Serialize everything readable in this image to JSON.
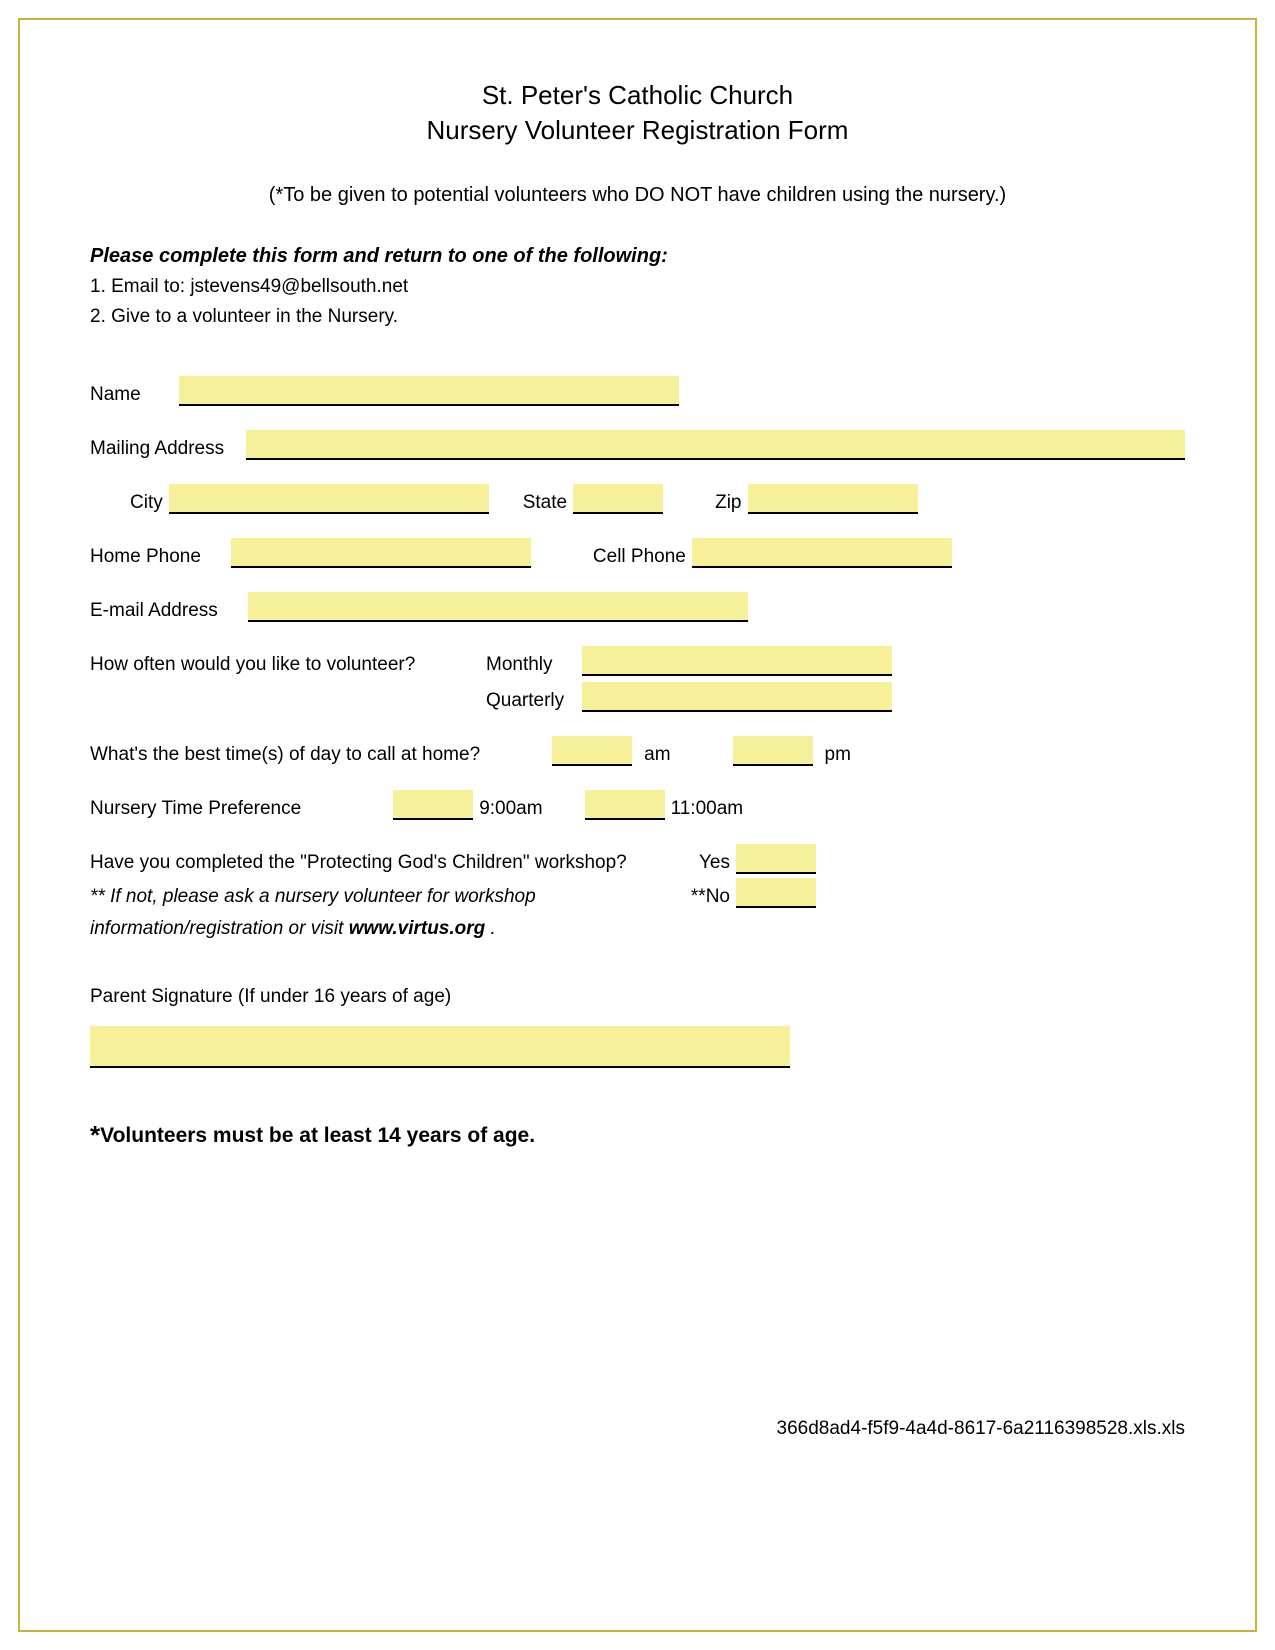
{
  "header": {
    "line1": "St. Peter's Catholic Church",
    "line2": "Nursery Volunteer Registration Form"
  },
  "note": "(*To be given to potential volunteers who DO NOT have children using the nursery.)",
  "instructions": {
    "heading": "Please complete this form and return to one of the following:",
    "items": [
      "1. Email to: jstevens49@bellsouth.net",
      "2. Give to a volunteer in the Nursery."
    ]
  },
  "fields": {
    "name": "Name",
    "mailing_address": "Mailing Address",
    "city": "City",
    "state": "State",
    "zip": "Zip",
    "home_phone": "Home Phone",
    "cell_phone": "Cell Phone",
    "email": "E-mail Address",
    "frequency_q": "How often would you like to volunteer?",
    "monthly": "Monthly",
    "quarterly": "Quarterly",
    "best_time_q": "What's the best time(s) of day to call at home?",
    "am": "am",
    "pm": "pm",
    "nursery_pref": "Nursery Time Preference",
    "t900": "9:00am",
    "t1100": "11:00am",
    "workshop_q": "Have you completed the \"Protecting God's Children\" workshop?",
    "yes": "Yes",
    "no_prefix": "**",
    "no": "No",
    "workshop_note1": "** If not, please ask a nursery volunteer for workshop",
    "workshop_note2_a": "information/registration or visit ",
    "workshop_note2_b": "www.virtus.org",
    "workshop_note2_c": " .",
    "parent_sig": "Parent Signature (If under 16 years of age)",
    "age_note": "Volunteers must be at least 14 years of age."
  },
  "footer": {
    "id": "366d8ad4-f5f9-4a4d-8617-6a2116398528.xls.xls"
  }
}
